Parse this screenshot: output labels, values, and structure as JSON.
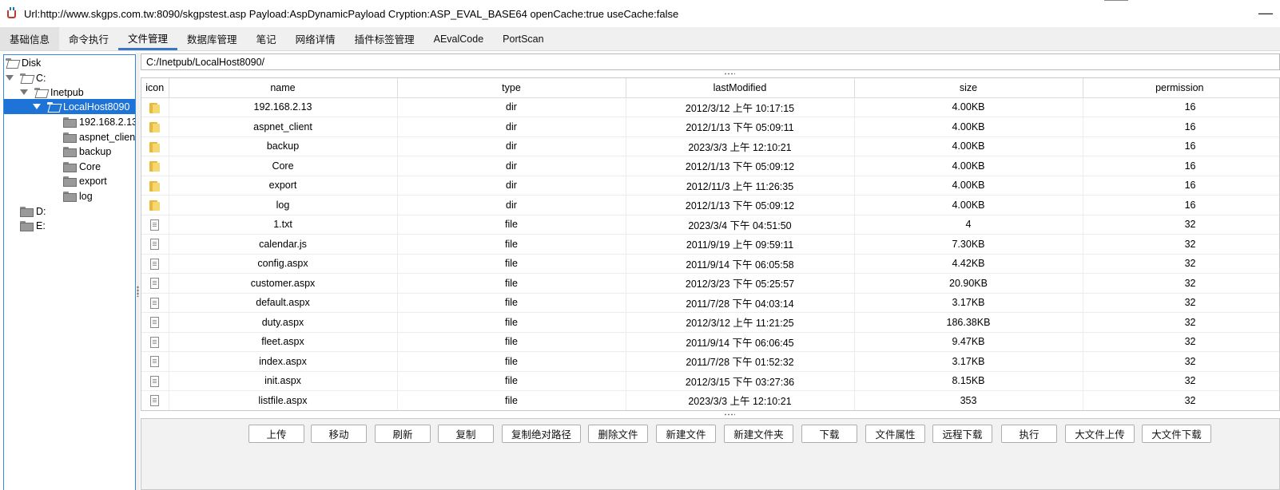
{
  "window": {
    "title": "Url:http://www.skgps.com.tw:8090/skgpstest.asp Payload:AspDynamicPayload Cryption:ASP_EVAL_BASE64 openCache:true useCache:false",
    "close_glyph": "—"
  },
  "tabs": [
    "基础信息",
    "命令执行",
    "文件管理",
    "数据库管理",
    "笔记",
    "网络详情",
    "插件标签管理",
    "AEvalCode",
    "PortScan"
  ],
  "active_tab": "文件管理",
  "tree": {
    "root": "Disk",
    "items": [
      {
        "label": "C:"
      },
      {
        "label": "Inetpub"
      },
      {
        "label": "LocalHost8090"
      },
      {
        "label": "192.168.2.13"
      },
      {
        "label": "aspnet_client"
      },
      {
        "label": "backup"
      },
      {
        "label": "Core"
      },
      {
        "label": "export"
      },
      {
        "label": "log"
      },
      {
        "label": "D:"
      },
      {
        "label": "E:"
      }
    ]
  },
  "path": "C:/Inetpub/LocalHost8090/",
  "table": {
    "columns": [
      "icon",
      "name",
      "type",
      "lastModified",
      "size",
      "permission"
    ],
    "rows": [
      {
        "icon": "folder-icon",
        "name": "192.168.2.13",
        "type": "dir",
        "lastModified": "2012/3/12 上午 10:17:15",
        "size": "4.00KB",
        "permission": "16"
      },
      {
        "icon": "folder-icon",
        "name": "aspnet_client",
        "type": "dir",
        "lastModified": "2012/1/13 下午 05:09:11",
        "size": "4.00KB",
        "permission": "16"
      },
      {
        "icon": "folder-icon",
        "name": "backup",
        "type": "dir",
        "lastModified": "2023/3/3 上午 12:10:21",
        "size": "4.00KB",
        "permission": "16"
      },
      {
        "icon": "folder-icon",
        "name": "Core",
        "type": "dir",
        "lastModified": "2012/1/13 下午 05:09:12",
        "size": "4.00KB",
        "permission": "16"
      },
      {
        "icon": "folder-icon",
        "name": "export",
        "type": "dir",
        "lastModified": "2012/11/3 上午 11:26:35",
        "size": "4.00KB",
        "permission": "16"
      },
      {
        "icon": "folder-icon",
        "name": "log",
        "type": "dir",
        "lastModified": "2012/1/13 下午 05:09:12",
        "size": "4.00KB",
        "permission": "16"
      },
      {
        "icon": "file-icon",
        "name": "1.txt",
        "type": "file",
        "lastModified": "2023/3/4 下午 04:51:50",
        "size": "4",
        "permission": "32"
      },
      {
        "icon": "file-icon",
        "name": "calendar.js",
        "type": "file",
        "lastModified": "2011/9/19 上午 09:59:11",
        "size": "7.30KB",
        "permission": "32"
      },
      {
        "icon": "file-icon",
        "name": "config.aspx",
        "type": "file",
        "lastModified": "2011/9/14 下午 06:05:58",
        "size": "4.42KB",
        "permission": "32"
      },
      {
        "icon": "file-icon",
        "name": "customer.aspx",
        "type": "file",
        "lastModified": "2012/3/23 下午 05:25:57",
        "size": "20.90KB",
        "permission": "32"
      },
      {
        "icon": "file-icon",
        "name": "default.aspx",
        "type": "file",
        "lastModified": "2011/7/28 下午 04:03:14",
        "size": "3.17KB",
        "permission": "32"
      },
      {
        "icon": "file-icon",
        "name": "duty.aspx",
        "type": "file",
        "lastModified": "2012/3/12 上午 11:21:25",
        "size": "186.38KB",
        "permission": "32"
      },
      {
        "icon": "file-icon",
        "name": "fleet.aspx",
        "type": "file",
        "lastModified": "2011/9/14 下午 06:06:45",
        "size": "9.47KB",
        "permission": "32"
      },
      {
        "icon": "file-icon",
        "name": "index.aspx",
        "type": "file",
        "lastModified": "2011/7/28 下午 01:52:32",
        "size": "3.17KB",
        "permission": "32"
      },
      {
        "icon": "file-icon",
        "name": "init.aspx",
        "type": "file",
        "lastModified": "2012/3/15 下午 03:27:36",
        "size": "8.15KB",
        "permission": "32"
      },
      {
        "icon": "file-icon",
        "name": "listfile.aspx",
        "type": "file",
        "lastModified": "2023/3/3 上午 12:10:21",
        "size": "353",
        "permission": "32"
      }
    ]
  },
  "buttons": [
    "上传",
    "移动",
    "刷新",
    "复制",
    "复制绝对路径",
    "删除文件",
    "新建文件",
    "新建文件夹",
    "下载",
    "文件属性",
    "远程下载",
    "执行",
    "大文件上传",
    "大文件下载"
  ]
}
